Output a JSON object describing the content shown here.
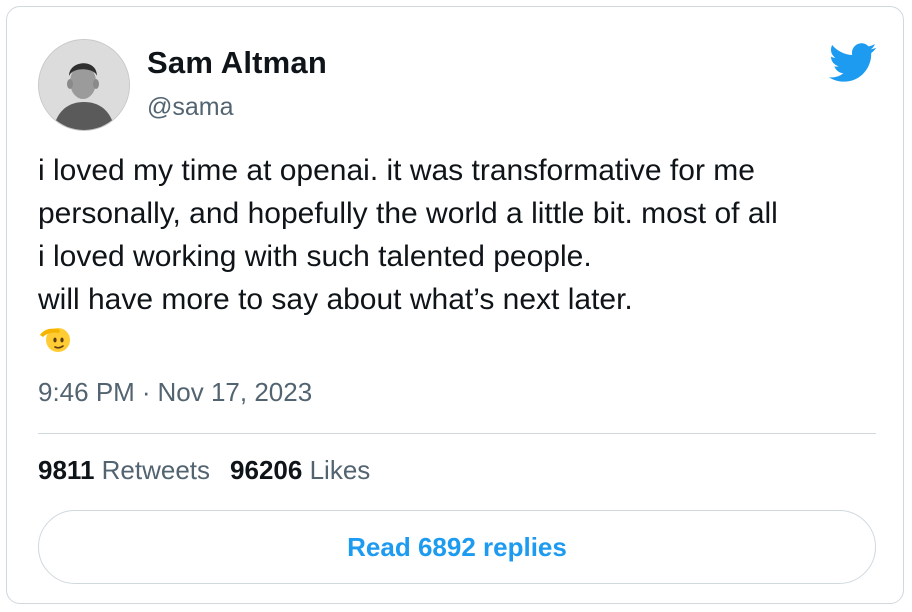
{
  "author": {
    "name": "Sam Altman",
    "handle": "@sama"
  },
  "icons": {
    "brand": "twitter-bird-icon",
    "emoji": "saluting-face-emoji"
  },
  "tweet": {
    "lines": [
      "i loved my time at openai. it was transformative for me",
      "personally, and hopefully the world a little bit. most of all",
      "i loved working with such talented people.",
      "will have more to say about what’s next later."
    ],
    "time": "9:46 PM",
    "separator": "·",
    "date": "Nov 17, 2023"
  },
  "stats": {
    "retweets_count": "9811",
    "retweets_label": "Retweets",
    "likes_count": "96206",
    "likes_label": "Likes"
  },
  "replies_button": {
    "label": "Read 6892 replies"
  },
  "colors": {
    "brand_blue": "#1d9bf0",
    "text_primary": "#0f1419",
    "text_secondary": "#536471",
    "border": "#cfd9de"
  }
}
